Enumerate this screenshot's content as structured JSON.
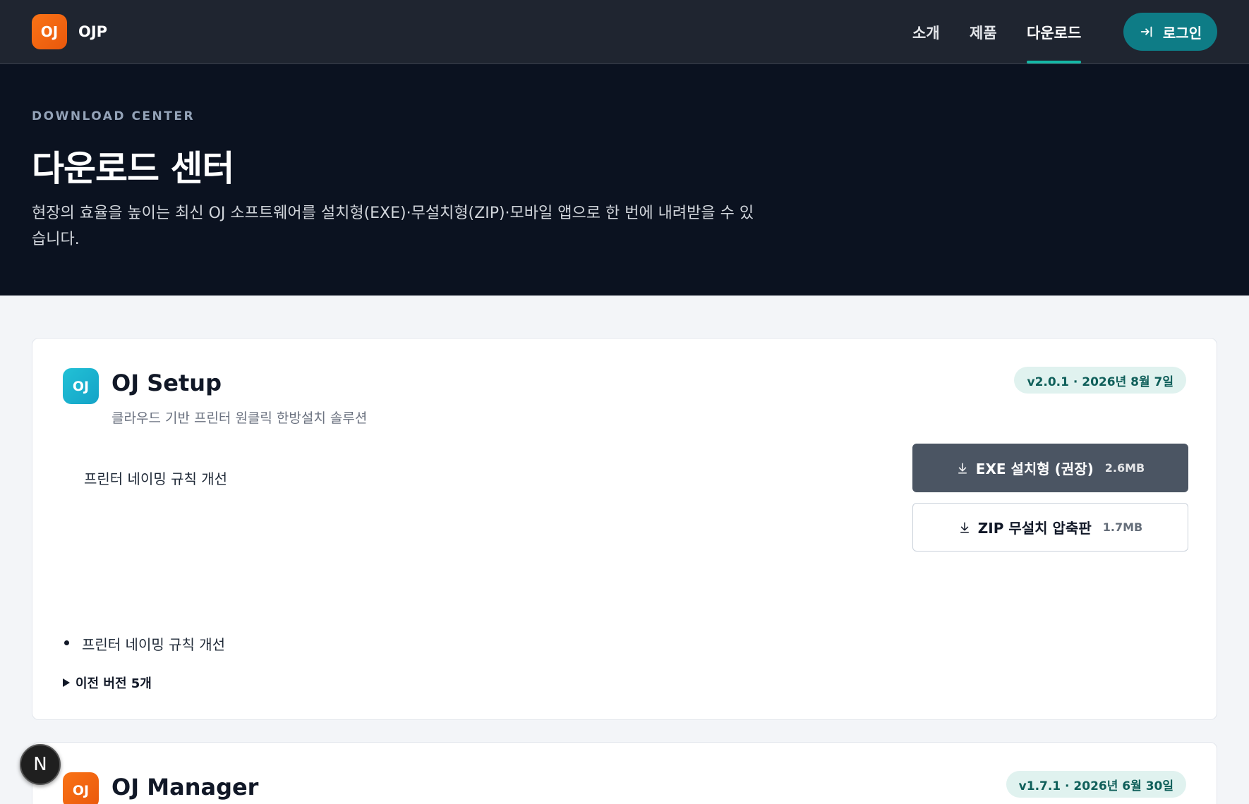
{
  "brand": {
    "logo_text": "OJ",
    "name": "OJP"
  },
  "nav": {
    "links": [
      {
        "label": "소개"
      },
      {
        "label": "제품"
      },
      {
        "label": "다운로드"
      }
    ],
    "active": "다운로드",
    "login_label": "로그인"
  },
  "hero": {
    "eyebrow": "DOWNLOAD CENTER",
    "title": "다운로드 센터",
    "description": "현장의 효율을 높이는 최신 OJ 소프트웨어를 설치형(EXE)·무설치형(ZIP)·모바일 앱으로 한 번에 내려받을 수 있습니다."
  },
  "products": [
    {
      "icon_text": "OJ",
      "name": "OJ Setup",
      "subtitle": "클라우드 기반 프린터 원클릭 한방설치 솔루션",
      "version": "v2.0.1 · 2026년 8월 7일",
      "changelog": "프린터 네이밍 규칙 개선",
      "downloads": [
        {
          "label": "EXE 설치형 (권장)",
          "size": "2.6MB"
        },
        {
          "label": "ZIP 무설치 압축판",
          "size": "1.7MB"
        }
      ],
      "notes": [
        "프린터 네이밍 규칙 개선"
      ],
      "previous_versions": "이전 버전 5개"
    },
    {
      "icon_text": "OJ",
      "name": "OJ Manager",
      "version": "v1.7.1 · 2026년 6월 30일"
    }
  ],
  "floating_badge": "N",
  "colors": {
    "nav_bg": "#1f2530",
    "hero_bg": "#0b1220",
    "accent_teal": "#0e7c86",
    "brand_orange": "#f97316",
    "exe_button": "#4b5563"
  }
}
